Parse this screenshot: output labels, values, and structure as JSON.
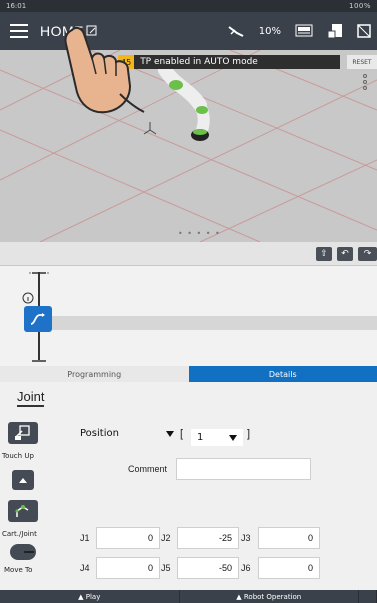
{
  "status_bar": {
    "time": "16:01",
    "right": "100%"
  },
  "top_bar": {
    "title": "HOME",
    "speed_percent": "10%"
  },
  "viewport": {
    "banner_code": "45",
    "banner_text": "TP enabled in AUTO mode",
    "reset_label": "RESET"
  },
  "tabs": {
    "programming": "Programming",
    "details": "Details"
  },
  "details": {
    "section_title": "Joint",
    "touch_up_label": "Touch Up",
    "cart_joint_label": "Cart./Joint",
    "move_to_label": "Move To",
    "position_select": "Position",
    "index_select": "1",
    "open_bracket": "[",
    "close_bracket": "]",
    "comment_label": "Comment",
    "comment_value": "",
    "joints": [
      {
        "label": "J1",
        "value": "0"
      },
      {
        "label": "J2",
        "value": "-25"
      },
      {
        "label": "J3",
        "value": "0"
      },
      {
        "label": "J4",
        "value": "0"
      },
      {
        "label": "J5",
        "value": "-50"
      },
      {
        "label": "J6",
        "value": "0"
      }
    ]
  },
  "bottom_bar": {
    "play": "▲ Play",
    "robot_operation": "▲ Robot Operation"
  },
  "colors": {
    "accent_blue": "#1170c2",
    "banner_yellow": "#f2b51b",
    "topbar": "#3b414b"
  },
  "icons": [
    "menu-icon",
    "edit-icon",
    "tool-icon",
    "speed-icon",
    "teach-pendant-icon",
    "monitor-icon",
    "kebab-menu-icon",
    "upload-icon",
    "undo-icon",
    "redo-icon",
    "move-node-icon",
    "touch-up-icon",
    "cart-joint-icon",
    "move-to-icon"
  ]
}
